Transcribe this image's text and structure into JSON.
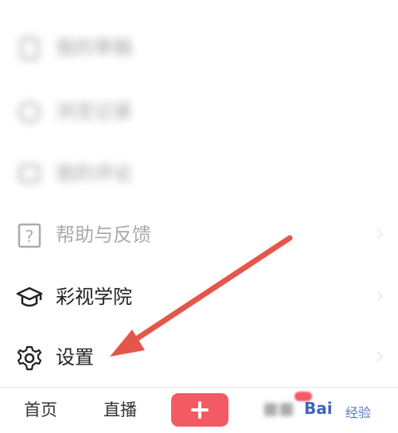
{
  "menu": {
    "items": [
      {
        "label": "我的草稿",
        "icon": "document-icon",
        "state": "blurred"
      },
      {
        "label": "浏览记录",
        "icon": "clock-icon",
        "state": "blurred"
      },
      {
        "label": "我的评论",
        "icon": "comment-icon",
        "state": "blurred"
      },
      {
        "label": "帮助与反馈",
        "icon": "help-question-icon",
        "state": "faded"
      },
      {
        "label": "彩视学院",
        "icon": "graduation-cap-icon",
        "state": "normal"
      },
      {
        "label": "设置",
        "icon": "gear-icon",
        "state": "normal"
      }
    ]
  },
  "annotation": {
    "type": "arrow",
    "color": "#e5564a",
    "points_to": "settings"
  },
  "bottom_nav": {
    "home_label": "首页",
    "live_label": "直播",
    "add_icon": "plus-icon",
    "accent_color": "#f35a63"
  },
  "watermark": {
    "brand": "Bai",
    "suffix": "经验"
  }
}
